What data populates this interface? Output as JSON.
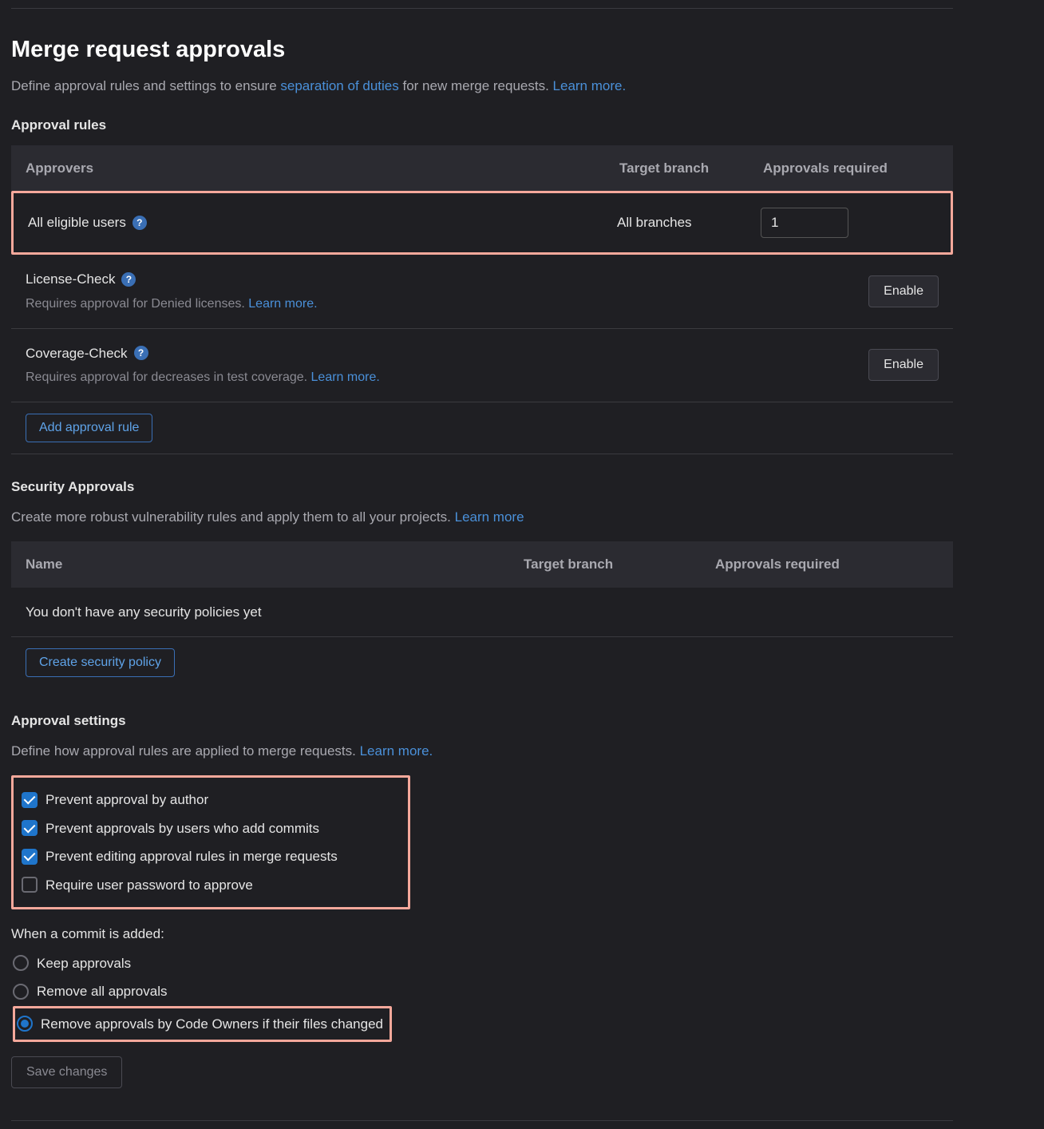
{
  "header": {
    "title": "Merge request approvals",
    "subtitle_pre": "Define approval rules and settings to ensure ",
    "subtitle_link1": "separation of duties",
    "subtitle_mid": " for new merge requests. ",
    "subtitle_link2": "Learn more."
  },
  "approval_rules": {
    "label": "Approval rules",
    "columns": {
      "c1": "Approvers",
      "c2": "Target branch",
      "c3": "Approvals required"
    },
    "rows": [
      {
        "name": "All eligible users",
        "branch": "All branches",
        "required": "1",
        "has_help": true,
        "description": "",
        "learn_more": "",
        "enable_label": "",
        "highlighted": true
      },
      {
        "name": "License-Check",
        "branch": "",
        "required": "",
        "has_help": true,
        "description": "Requires approval for Denied licenses. ",
        "learn_more": "Learn more.",
        "enable_label": "Enable",
        "highlighted": false
      },
      {
        "name": "Coverage-Check",
        "branch": "",
        "required": "",
        "has_help": true,
        "description": "Requires approval for decreases in test coverage. ",
        "learn_more": "Learn more.",
        "enable_label": "Enable",
        "highlighted": false
      }
    ],
    "add_button": "Add approval rule"
  },
  "security": {
    "label": "Security Approvals",
    "subtitle_pre": "Create more robust vulnerability rules and apply them to all your projects. ",
    "subtitle_link": "Learn more",
    "columns": {
      "c1": "Name",
      "c2": "Target branch",
      "c3": "Approvals required"
    },
    "empty": "You don't have any security policies yet",
    "create_button": "Create security policy"
  },
  "settings": {
    "label": "Approval settings",
    "subtitle_pre": "Define how approval rules are applied to merge requests. ",
    "subtitle_link": "Learn more.",
    "checkboxes": [
      {
        "label": "Prevent approval by author",
        "checked": true
      },
      {
        "label": "Prevent approvals by users who add commits",
        "checked": true
      },
      {
        "label": "Prevent editing approval rules in merge requests",
        "checked": true
      },
      {
        "label": "Require user password to approve",
        "checked": false
      }
    ],
    "commit_label": "When a commit is added:",
    "radios": [
      {
        "label": "Keep approvals",
        "selected": false
      },
      {
        "label": "Remove all approvals",
        "selected": false
      },
      {
        "label": "Remove approvals by Code Owners if their files changed",
        "selected": true
      }
    ],
    "save_button": "Save changes"
  }
}
